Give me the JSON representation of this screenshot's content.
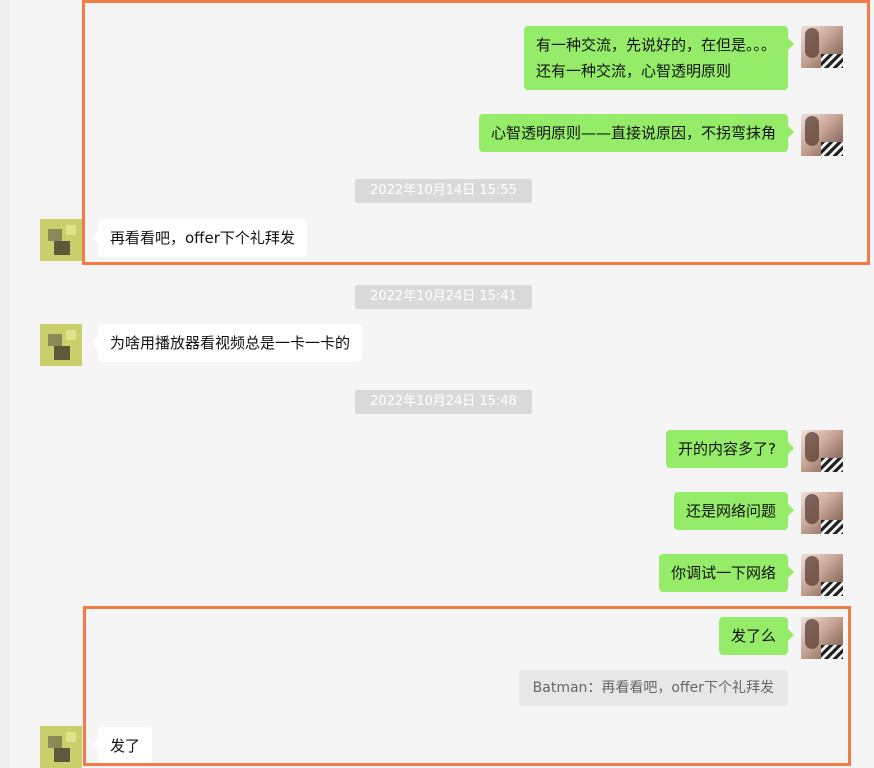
{
  "messages": [
    {
      "side": "out",
      "lines": [
        "有一种交流，先说好的，在但是。。。",
        "还有一种交流，心智透明原则"
      ]
    },
    {
      "side": "out",
      "text": "心智透明原则——直接说原因，不拐弯抹角"
    },
    {
      "side": "in",
      "text": "再看看吧，offer下个礼拜发"
    },
    {
      "side": "in",
      "text": "为啥用播放器看视频总是一卡一卡的"
    },
    {
      "side": "out",
      "text": "开的内容多了?"
    },
    {
      "side": "out",
      "text": "还是网络问题"
    },
    {
      "side": "out",
      "text": "你调试一下网络"
    },
    {
      "side": "out",
      "text": "发了么"
    },
    {
      "side": "in",
      "text": "发了"
    }
  ],
  "timestamps": [
    "2022年10月14日 15:55",
    "2022年10月24日 15:41",
    "2022年10月24日 15:48"
  ],
  "quote": {
    "text": "Batman：再看看吧，offer下个礼拜发"
  },
  "colors": {
    "outgoing_bubble": "#95ec69",
    "incoming_bubble": "#ffffff",
    "highlight_border": "#f47a46",
    "background": "#f5f5f5"
  }
}
